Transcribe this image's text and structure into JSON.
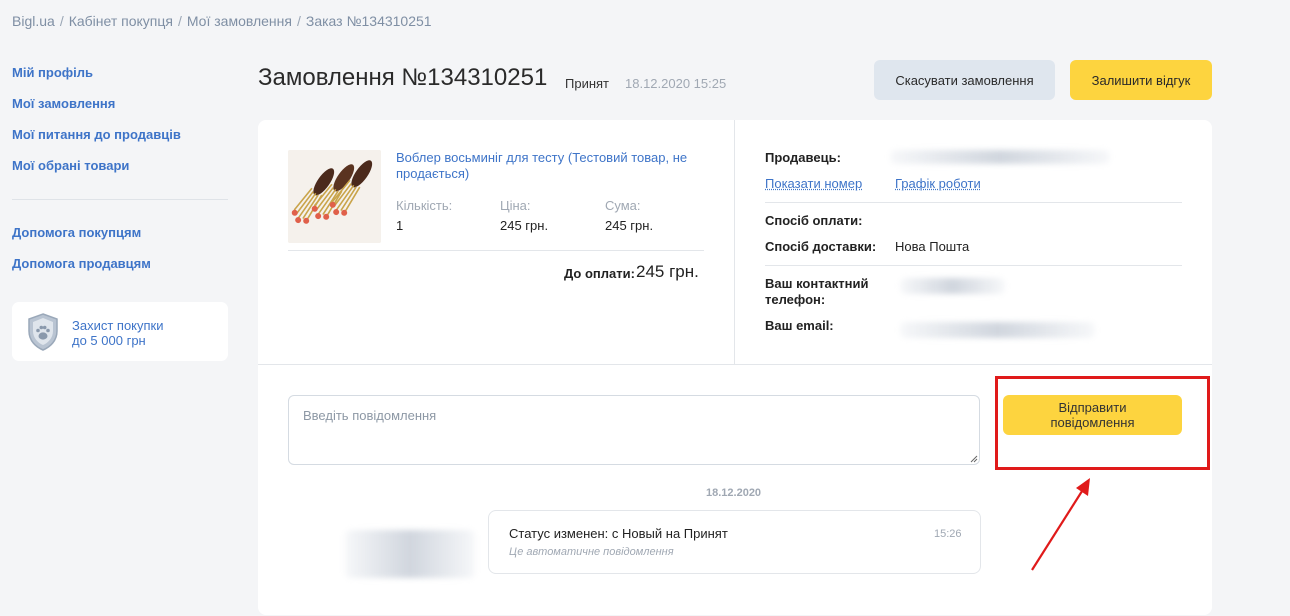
{
  "breadcrumb": [
    "Bigl.ua",
    "Кабінет покупця",
    "Мої замовлення",
    "Заказ №134310251"
  ],
  "breadcrumb_sep": "/",
  "sidebar": {
    "items": [
      {
        "label": "Мій профіль"
      },
      {
        "label": "Мої замовлення"
      },
      {
        "label": "Мої питання до продавців"
      },
      {
        "label": "Мої обрані товари"
      }
    ],
    "help": [
      {
        "label": "Допомога покупцям"
      },
      {
        "label": "Допомога продавцям"
      }
    ],
    "protection": {
      "line1": "Захист покупки",
      "line2": "до 5 000 грн",
      "icon": "shield-paw-icon"
    }
  },
  "order": {
    "title": "Замовлення №134310251",
    "status": "Принят",
    "date": "18.12.2020 15:25",
    "cancel_label": "Скасувати замовлення",
    "review_label": "Залишити відгук"
  },
  "product": {
    "name": "Воблер восьминіг для тесту (Тестовий товар, не продається)",
    "qty_label": "Кількість:",
    "qty": "1",
    "price_label": "Ціна:",
    "price": "245 грн.",
    "sum_label": "Сума:",
    "sum": "245 грн.",
    "total_label": "До оплати:",
    "total": "245 грн."
  },
  "seller": {
    "seller_label": "Продавець:",
    "show_phone": "Показати номер",
    "schedule": "Графік роботи",
    "payment_label": "Спосіб оплати:",
    "delivery_label": "Спосіб доставки:",
    "delivery_value": "Нова Пошта",
    "phone_label": "Ваш контактний телефон:",
    "email_label": "Ваш email:"
  },
  "message": {
    "placeholder": "Введіть повідомлення",
    "send_line1": "Відправити",
    "send_line2": "повідомлення",
    "date_sep": "18.12.2020",
    "bubble_text": "Статус изменен: с Новый на Принят",
    "bubble_time": "15:26",
    "bubble_note": "Це автоматичне повідомлення"
  },
  "colors": {
    "accent_yellow": "#fdd43f",
    "link_blue": "#3e74c8",
    "highlight_red": "#e01a1a"
  }
}
